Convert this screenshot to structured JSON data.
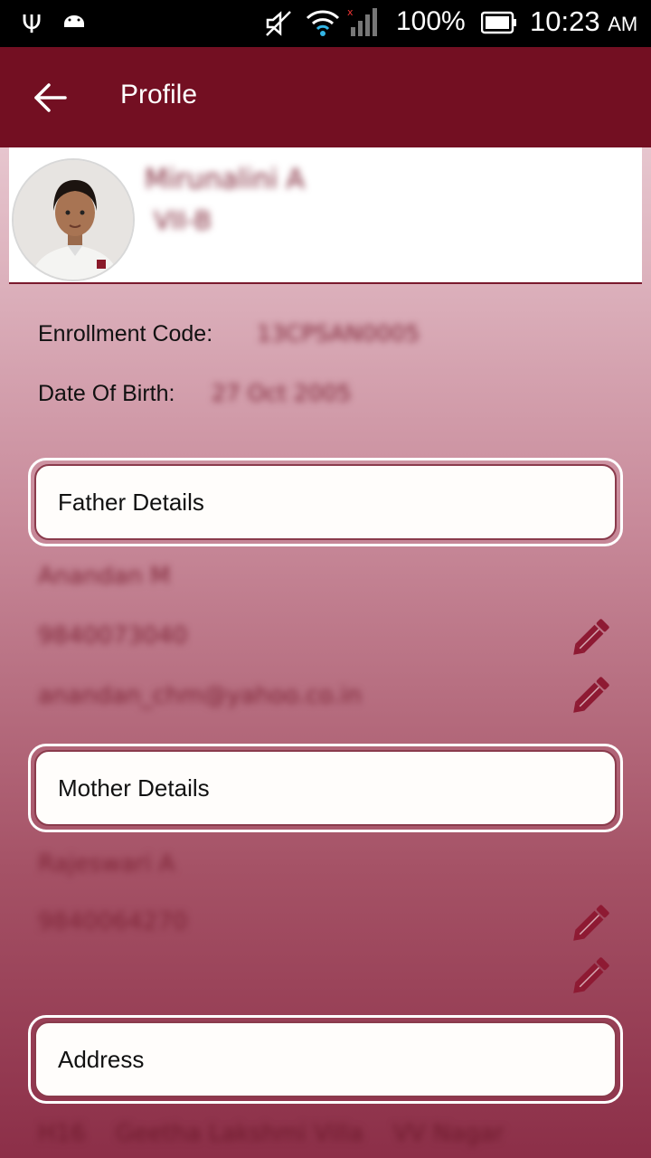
{
  "status_bar": {
    "battery_percent": "100%",
    "time": "10:23",
    "ampm": "AM",
    "icons": [
      "usb-icon",
      "android-icon",
      "mute-icon",
      "wifi-icon",
      "signal-icon",
      "battery-icon"
    ]
  },
  "app_bar": {
    "title": "Profile",
    "back_icon": "arrow-left-icon",
    "color": "#730f22"
  },
  "student": {
    "name": "Mirunalini A",
    "class": "VII-B"
  },
  "info": {
    "enrollment_label": "Enrollment Code:",
    "enrollment_value": "13CPSAN0005",
    "dob_label": "Date Of Birth:",
    "dob_value": "27 Oct 2005"
  },
  "father": {
    "section_label": "Father Details",
    "name": "Anandan M",
    "phone": "9840073040",
    "email": "anandan_chm@yahoo.co.in"
  },
  "mother": {
    "section_label": "Mother Details",
    "name": "Rajeswari A",
    "phone": "9840064270"
  },
  "address": {
    "section_label": "Address",
    "line": "H16    Geetha Lakshmi Villa    VV Nagar"
  },
  "colors": {
    "accent": "#730f22",
    "edit_icon": "#8e1a33"
  }
}
